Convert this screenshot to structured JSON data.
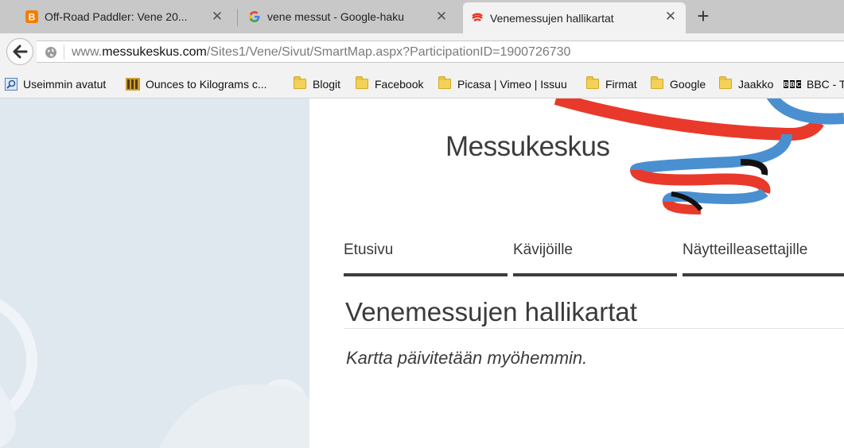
{
  "tabs": [
    {
      "title": "Off-Road Paddler: Vene 20...",
      "favicon": "blogger-icon"
    },
    {
      "title": "vene messut - Google-haku",
      "favicon": "google-icon"
    },
    {
      "title": "Venemessujen hallikartat",
      "favicon": "messukeskus-icon",
      "active": true
    }
  ],
  "address": {
    "prefix": "www.",
    "domain": "messukeskus.com",
    "path": "/Sites1/Vene/Sivut/SmartMap.aspx?ParticipationID=1900726730"
  },
  "bookmarks": [
    {
      "label": "Useimmin avatut",
      "icon": "search-bookmark-icon"
    },
    {
      "label": "Ounces to Kilograms c...",
      "icon": "book-icon"
    },
    {
      "label": "Blogit",
      "icon": "folder-icon"
    },
    {
      "label": "Facebook",
      "icon": "folder-icon"
    },
    {
      "label": "Picasa | Vimeo | Issuu",
      "icon": "folder-icon"
    },
    {
      "label": "Firmat",
      "icon": "folder-icon"
    },
    {
      "label": "Google",
      "icon": "folder-icon"
    },
    {
      "label": "Jaakko",
      "icon": "folder-icon"
    },
    {
      "label": "BBC - T",
      "icon": "bbc-icon"
    }
  ],
  "page": {
    "brand": "Messukeskus",
    "nav": [
      "Etusivu",
      "Kävijöille",
      "Näytteilleasettajille"
    ],
    "heading": "Venemessujen hallikartat",
    "note": "Kartta päivitetään myöhemmin."
  },
  "colors": {
    "ribbon_red": "#e8392b",
    "ribbon_blue": "#4a90d0",
    "left_panel": "#dfe7ef",
    "nav_bar": "#3d3d3d"
  }
}
